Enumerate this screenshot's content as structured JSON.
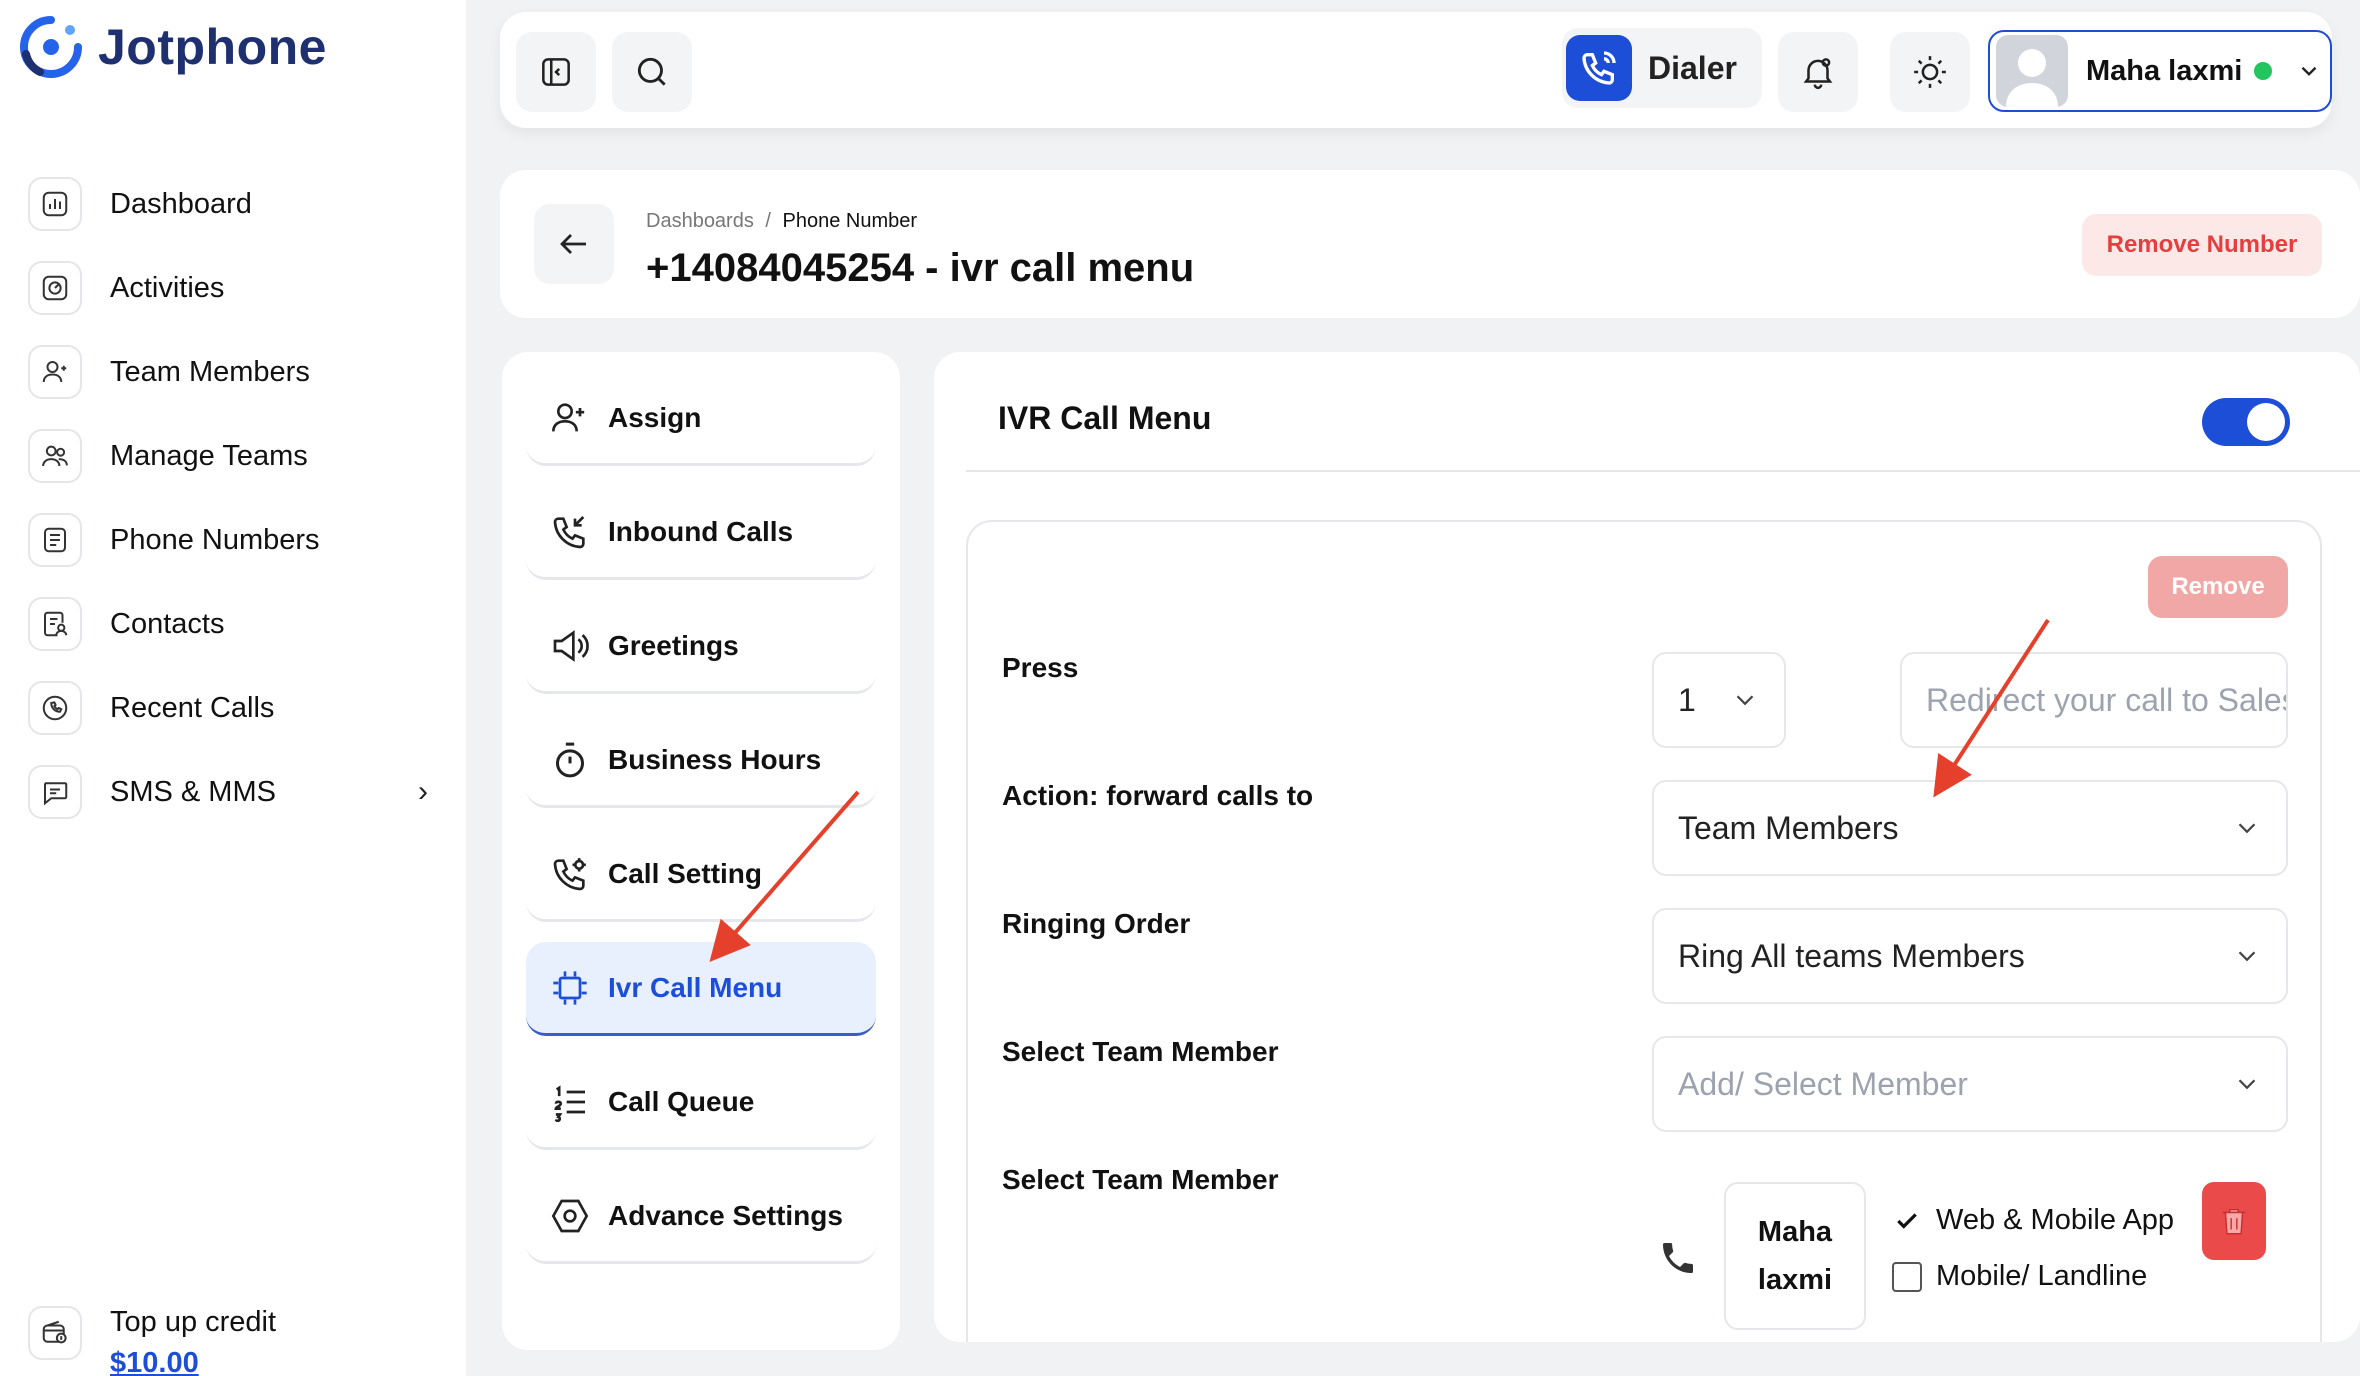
{
  "brand": {
    "name": "Jotphone"
  },
  "sidebar": {
    "items": [
      {
        "label": "Dashboard",
        "icon": "chart-icon"
      },
      {
        "label": "Activities",
        "icon": "activity-icon"
      },
      {
        "label": "Team Members",
        "icon": "user-icon"
      },
      {
        "label": "Manage Teams",
        "icon": "users-icon"
      },
      {
        "label": "Phone Numbers",
        "icon": "phone-list-icon"
      },
      {
        "label": "Contacts",
        "icon": "contacts-icon"
      },
      {
        "label": "Recent Calls",
        "icon": "recent-calls-icon"
      },
      {
        "label": "SMS & MMS",
        "icon": "message-icon",
        "chevron": "›"
      }
    ],
    "topup": {
      "label": "Top up credit",
      "amount": "$10.00"
    }
  },
  "header": {
    "dialer_label": "Dialer",
    "user_name": "Maha laxmi",
    "status_color": "#22c55e"
  },
  "titlebar": {
    "breadcrumb_root": "Dashboards",
    "breadcrumb_sep": "/",
    "breadcrumb_current": "Phone Number",
    "title": "+14084045254 - ivr call menu",
    "remove_number_label": "Remove Number"
  },
  "tabs": [
    {
      "label": "Assign",
      "icon": "user-plus-icon",
      "active": false
    },
    {
      "label": "Inbound Calls",
      "icon": "incoming-call-icon",
      "active": false
    },
    {
      "label": "Greetings",
      "icon": "megaphone-icon",
      "active": false
    },
    {
      "label": "Business Hours",
      "icon": "stopwatch-icon",
      "active": false
    },
    {
      "label": "Call Setting",
      "icon": "call-setting-icon",
      "active": false
    },
    {
      "label": "Ivr Call Menu",
      "icon": "ivr-icon",
      "active": true
    },
    {
      "label": "Call Queue",
      "icon": "numbered-list-icon",
      "active": false
    },
    {
      "label": "Advance Settings",
      "icon": "hexagon-gear-icon",
      "active": false
    }
  ],
  "ivr": {
    "title": "IVR Call Menu",
    "enabled": true,
    "remove_label": "Remove",
    "press_label": "Press",
    "press_value": "1",
    "redirect_placeholder": "Redirect your call to Sales",
    "action_label": "Action: forward calls to",
    "action_value": "Team Members",
    "ringing_label": "Ringing Order",
    "ringing_value": "Ring All teams Members",
    "select_member_label": "Select Team Member",
    "select_member_placeholder": "Add/ Select Member",
    "select_member_label_2": "Select Team Member",
    "member": {
      "first": "Maha",
      "last": "laxmi",
      "web_mobile_label": "Web & Mobile App",
      "web_mobile_checked": true,
      "landline_label": "Mobile/ Landline",
      "landline_checked": false
    }
  },
  "colors": {
    "accent": "#1d4ed8",
    "danger": "#e53e3e",
    "annotation_arrow": "#e4402b"
  }
}
